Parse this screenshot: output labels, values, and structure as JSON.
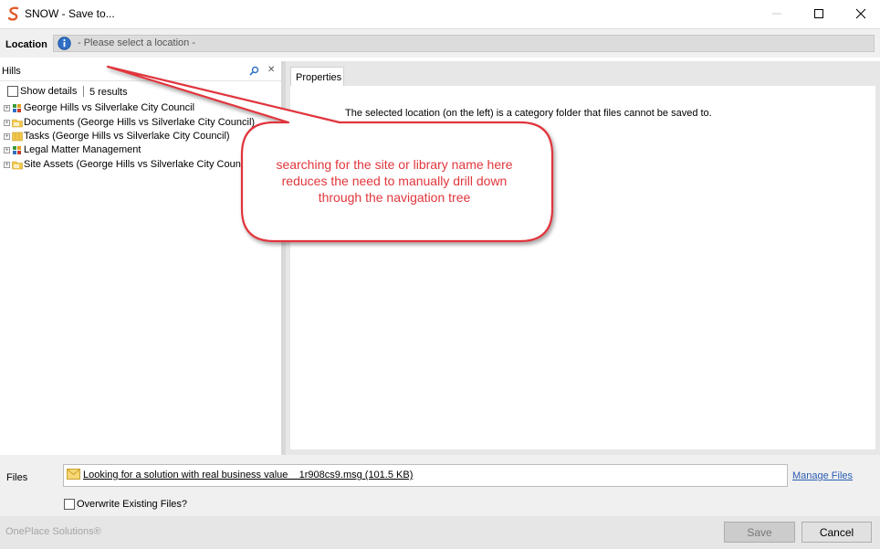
{
  "window": {
    "title": "SNOW - Save to...",
    "app_icon": "snow-logo-icon"
  },
  "location": {
    "label": "Location",
    "icon": "info-icon",
    "text": "- Please select a location -"
  },
  "search": {
    "value": "Hills",
    "show_details_label": "Show details",
    "results_text": "5 results"
  },
  "tree": [
    {
      "label": "George Hills vs Silverlake City Council",
      "icon": "site-icon"
    },
    {
      "label": "Documents (George Hills vs Silverlake City Council)",
      "icon": "library-folder-icon"
    },
    {
      "label": "Tasks (George Hills vs Silverlake City Council)",
      "icon": "tasks-list-icon"
    },
    {
      "label": "Legal Matter Management",
      "icon": "site-icon"
    },
    {
      "label": "Site Assets (George Hills vs Silverlake City Council)",
      "icon": "library-folder-icon"
    }
  ],
  "properties": {
    "tab_label": "Properties",
    "message": "The selected location (on the left) is a category folder that files cannot be saved to."
  },
  "callout": {
    "lines": [
      "searching for the site or library name here",
      "reduces the need to manually drill down",
      "through the navigation tree"
    ],
    "color": "#e0363c"
  },
  "files": {
    "label": "Files",
    "file_name": "Looking for a solution with real business value    1r908cs9.msg (101.5 KB)",
    "manage_files_label": "Manage Files",
    "overwrite_label": "Overwrite Existing Files?"
  },
  "footer": {
    "brand": "OnePlace Solutions®",
    "save_label": "Save",
    "cancel_label": "Cancel"
  }
}
